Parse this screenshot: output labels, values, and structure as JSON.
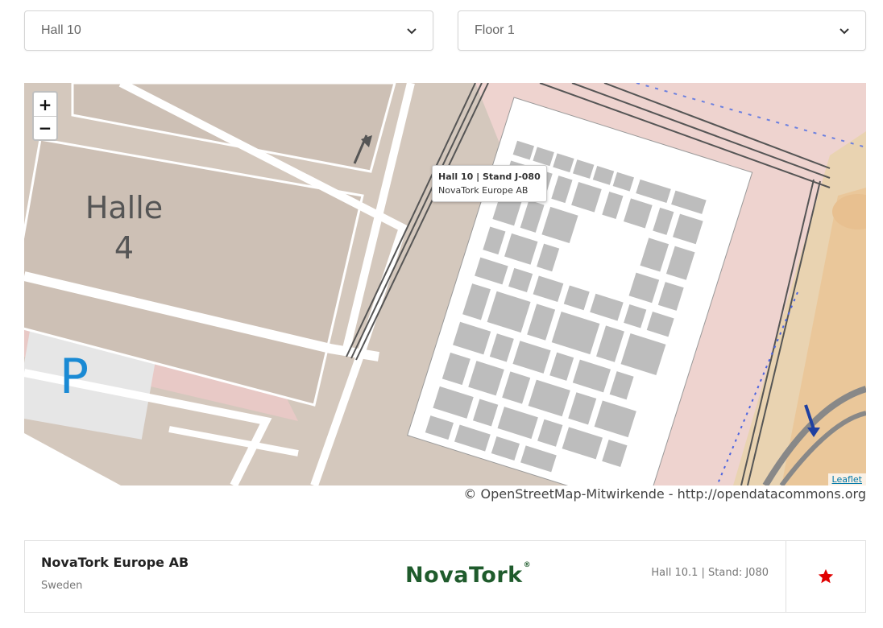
{
  "filters": {
    "hall": {
      "selected": "Hall 10"
    },
    "floor": {
      "selected": "Floor 1"
    }
  },
  "map": {
    "zoom_in_label": "+",
    "zoom_out_label": "−",
    "hall_label_line1": "Halle",
    "hall_label_line2": "4",
    "parking_label": "P",
    "tooltip": {
      "title": "Hall 10 | Stand J-080",
      "subtitle": "NovaTork Europe AB"
    },
    "leaflet_link": "Leaflet",
    "colors": {
      "ground": "#d4c8bd",
      "road": "#ffffff",
      "rail": "#555555",
      "hall_floor": "#ffffff",
      "stand": "#bdbdbd",
      "parking_text": "#1a8ad4",
      "highlight_stand": "#444444"
    }
  },
  "map_credit": "© OpenStreetMap-Mitwirkende - http://opendatacommons.org",
  "exhibitor": {
    "name": "NovaTork Europe AB",
    "country": "Sweden",
    "logo_text": "NovaTork",
    "logo_reg": "®",
    "stand": "Hall 10.1 | Stand: J080",
    "favorite_color": "#e00000",
    "logo_color": "#1f5b2c"
  }
}
